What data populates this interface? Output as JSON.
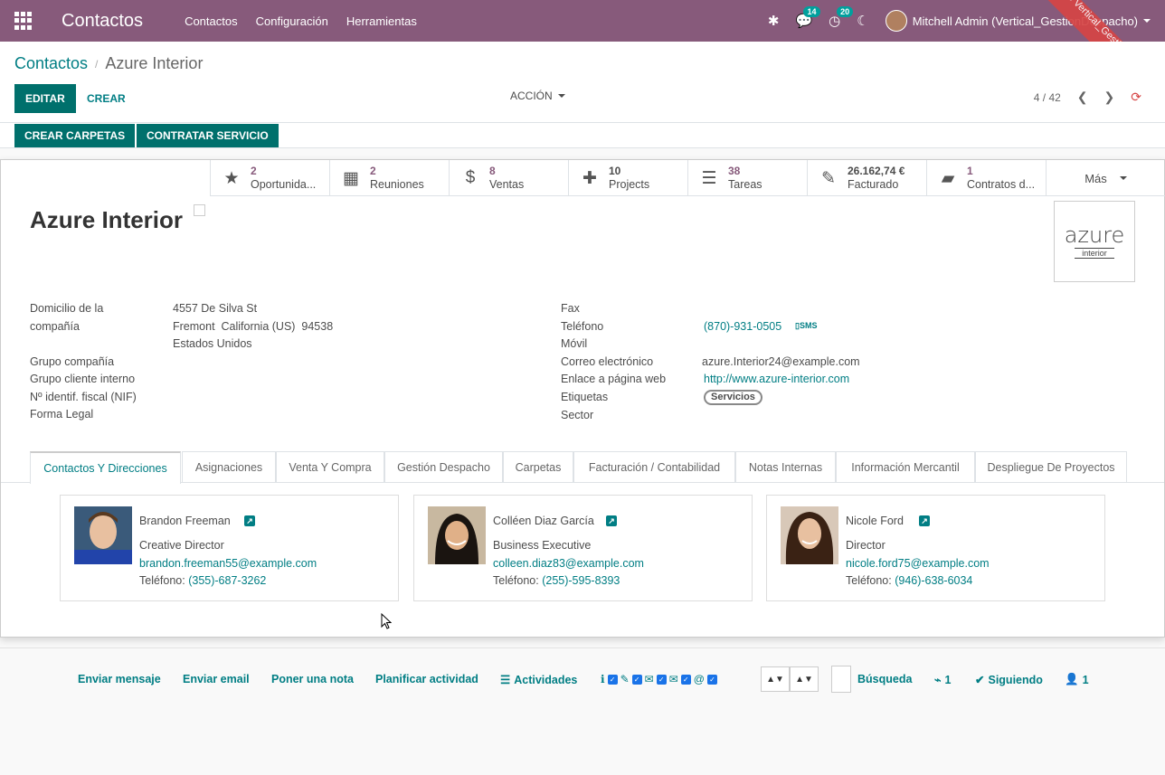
{
  "navbar": {
    "brand": "Contactos",
    "menu": [
      "Contactos",
      "Configuración",
      "Herramientas"
    ],
    "messages_badge": "14",
    "activities_badge": "20",
    "user_name": "Mitchell Admin (Vertical_GestionDespacho)",
    "ribbon_text": "Demo Vertical_GestionDespacho"
  },
  "breadcrumb": {
    "parent": "Contactos",
    "current": "Azure Interior"
  },
  "toolbar": {
    "edit": "EDITAR",
    "create": "CREAR",
    "action": "ACCIÓN",
    "pager": "4 / 42"
  },
  "header_buttons": {
    "create_folders": "CREAR CARPETAS",
    "hire_service": "CONTRATAR SERVICIO"
  },
  "smart_buttons": [
    {
      "icon": "star-icon",
      "value": "2",
      "label": "Oportunida..."
    },
    {
      "icon": "calendar-icon",
      "value": "2",
      "label": "Reuniones"
    },
    {
      "icon": "dollar-icon",
      "value": "8",
      "label": "Ventas"
    },
    {
      "icon": "puzzle-icon",
      "value": "10",
      "label": "Projects"
    },
    {
      "icon": "tasks-icon",
      "value": "38",
      "label": "Tareas"
    },
    {
      "icon": "invoice-icon",
      "value": "26.162,74 €",
      "label": "Facturado"
    },
    {
      "icon": "book-icon",
      "value": "1",
      "label": "Contratos d..."
    }
  ],
  "more_label": "Más",
  "partner": {
    "name": "Azure Interior",
    "logo_word": "azure",
    "logo_sub": "interior"
  },
  "fields_left": {
    "address_label_1": "Domicilio de la",
    "address_label_2": "compañía",
    "street": "4557 De Silva St",
    "city_line": "Fremont  California (US)  94538",
    "country": "Estados Unidos",
    "group_company": "Grupo compañía",
    "internal_group": "Grupo cliente interno",
    "vat": "Nº identif. fiscal (NIF)",
    "legal_form": "Forma Legal"
  },
  "fields_right": {
    "fax_label": "Fax",
    "phone_label": "Teléfono",
    "phone": "(870)-931-0505",
    "sms": "SMS",
    "mobile_label": "Móvil",
    "email_label": "Correo electrónico",
    "email": "azure.Interior24@example.com",
    "website_label": "Enlace a página web",
    "website": "http://www.azure-interior.com",
    "tags_label": "Etiquetas",
    "tag": "Servicios",
    "sector_label": "Sector"
  },
  "tabs": [
    "Contactos Y Direcciones",
    "Asignaciones",
    "Venta Y Compra",
    "Gestión Despacho",
    "Carpetas",
    "Facturación / Contabilidad",
    "Notas Internas",
    "Información Mercantil",
    "Despliegue De Proyectos"
  ],
  "contacts": [
    {
      "name": "Brandon Freeman",
      "function": "Creative Director",
      "email": "brandon.freeman55@example.com",
      "phone_label": "Teléfono:",
      "phone": "(355)-687-3262"
    },
    {
      "name": "Colléen Diaz García",
      "function": "Business Executive",
      "email": "colleen.diaz83@example.com",
      "phone_label": "Teléfono:",
      "phone": "(255)-595-8393"
    },
    {
      "name": "Nicole Ford",
      "function": "Director",
      "email": "nicole.ford75@example.com",
      "phone_label": "Teléfono:",
      "phone": "(946)-638-6034"
    }
  ],
  "chatter": {
    "send_message": "Enviar mensaje",
    "send_email": "Enviar email",
    "log_note": "Poner una nota",
    "schedule": "Planificar actividad",
    "activities": "Actividades",
    "search": "Búsqueda",
    "attachments": "1",
    "following": "Siguiendo",
    "followers": "1"
  },
  "colors": {
    "navbar": "#875a7b",
    "primary": "#00706c",
    "link": "#017e84",
    "ribbon": "#d64545"
  }
}
